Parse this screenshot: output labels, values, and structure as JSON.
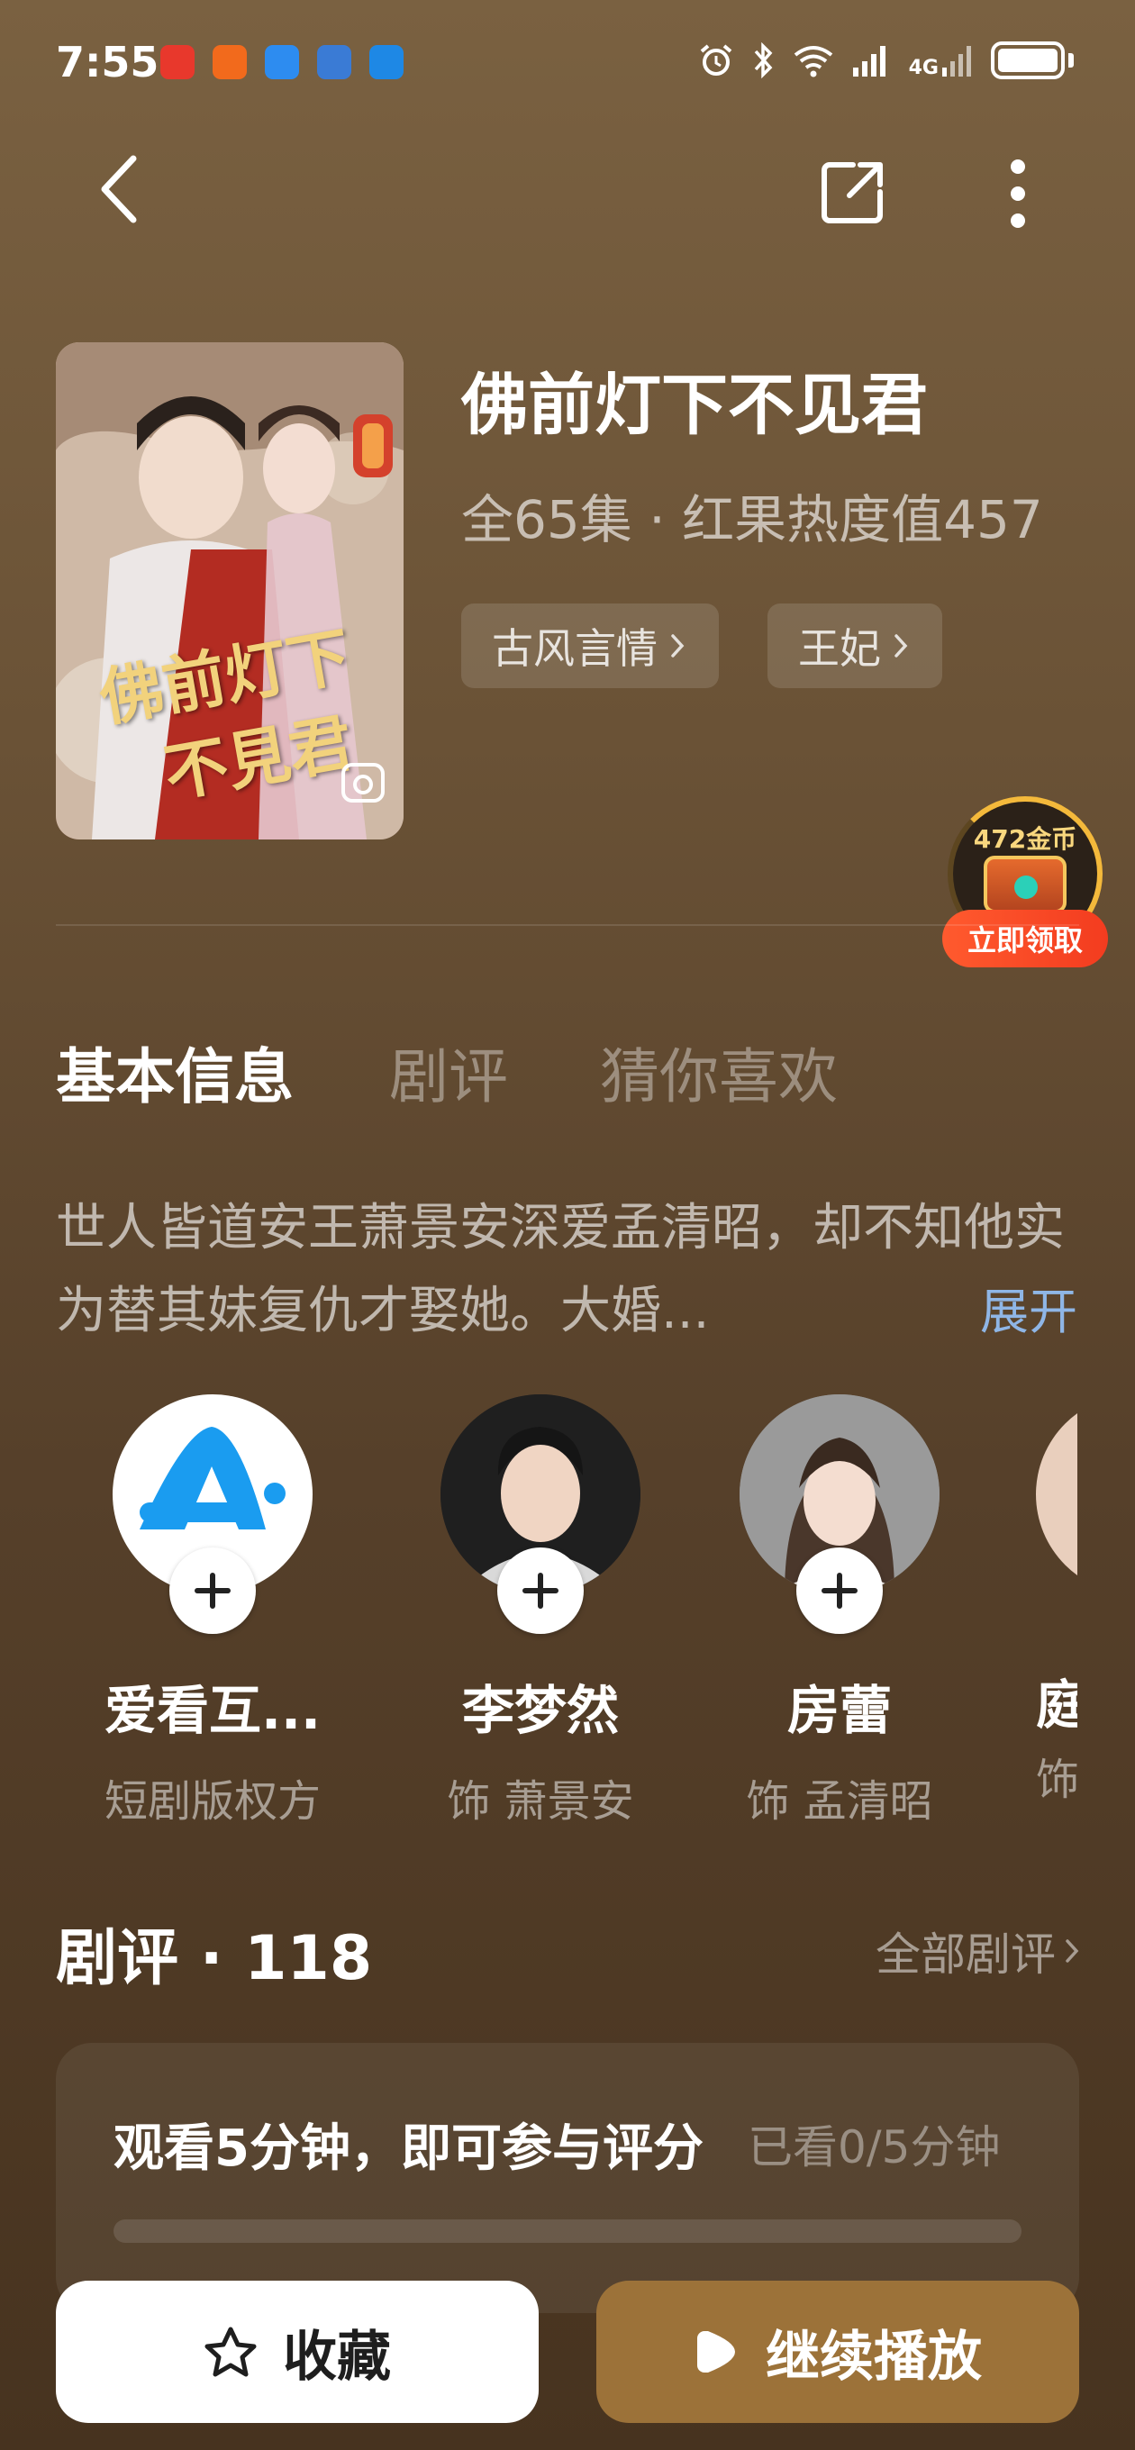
{
  "status_bar": {
    "time": "7:55",
    "notification_icons": [
      "app-red-icon",
      "app-orange-icon",
      "app-blue-chat-icon",
      "app-blue-bird-icon",
      "app-blue-compass-icon"
    ],
    "right_icons": [
      "alarm-icon",
      "bluetooth-icon",
      "wifi-icon",
      "signal-icon",
      "signal-4g-icon",
      "battery-icon"
    ],
    "network_label": "4G"
  },
  "nav": {
    "back_icon": "back-icon",
    "share_icon": "share-icon",
    "more_icon": "more-icon"
  },
  "drama": {
    "title": "佛前灯下不见君",
    "meta": "全65集 · 红果热度值457",
    "cover_text_line1": "佛前灯下",
    "cover_text_line2": "不見君",
    "tags": [
      {
        "label": "古风言情"
      },
      {
        "label": "王妃"
      }
    ]
  },
  "coin_widget": {
    "amount_label": "472金币",
    "claim_label": "立即领取"
  },
  "tabs": [
    {
      "label": "基本信息",
      "active": true
    },
    {
      "label": "剧评",
      "active": false
    },
    {
      "label": "猜你喜欢",
      "active": false
    }
  ],
  "synopsis": {
    "text": "世人皆道安王萧景安深爱孟清昭，却不知他实为替其妹复仇才娶她。大婚...",
    "expand_label": "展开"
  },
  "cast": [
    {
      "name": "爱看互...",
      "role": "短剧版权方"
    },
    {
      "name": "李梦然",
      "role": "饰 萧景安"
    },
    {
      "name": "房蕾",
      "role": "饰 孟清昭"
    },
    {
      "name": "庭",
      "role": "饰"
    }
  ],
  "reviews": {
    "title": "剧评",
    "count": "118",
    "all_label": "全部剧评",
    "prompt": "观看5分钟，即可参与评分",
    "progress_label": "已看0/5分钟",
    "progress_fraction": 0
  },
  "actions": {
    "favorite_label": "收藏",
    "play_label": "继续播放"
  },
  "colors": {
    "accent_gold": "#9c7239",
    "link_blue": "#8fb6e6",
    "coin_gold": "#f4b93b",
    "claim_red": "#f33c1f"
  }
}
